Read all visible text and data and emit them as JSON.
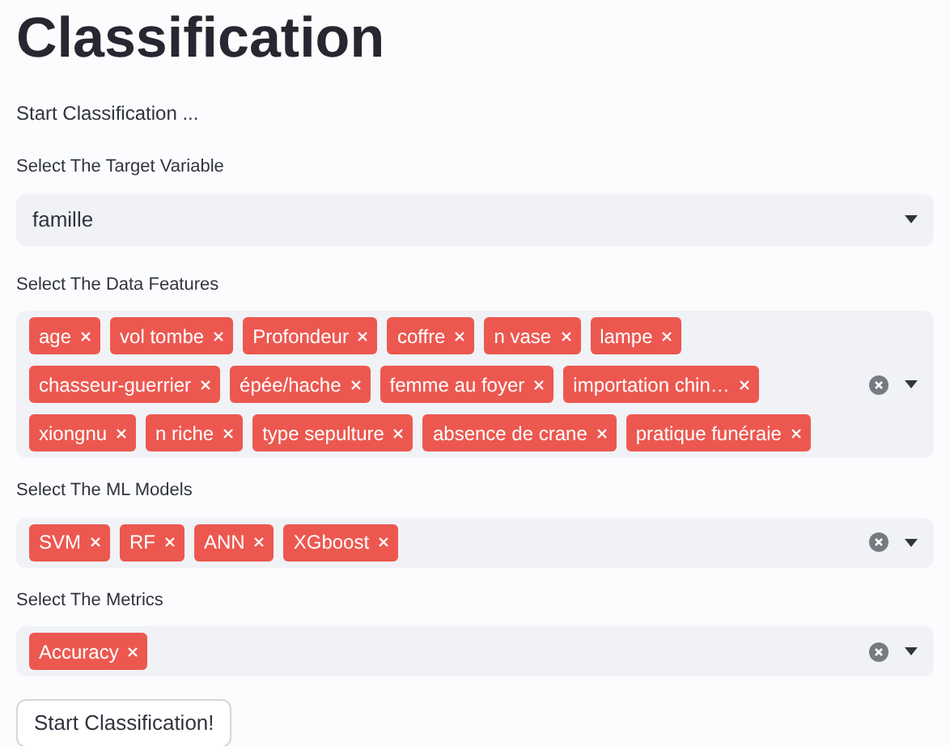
{
  "title": "Classification",
  "subtitle": "Start Classification ...",
  "target": {
    "label": "Select The Target Variable",
    "value": "famille"
  },
  "multiselects": [
    {
      "label": "Select The Data Features",
      "tags": [
        "age",
        "vol tombe",
        "Profondeur",
        "coffre",
        "n vase",
        "lampe",
        "chasseur-guerrier",
        "épée/hache",
        "femme au foyer",
        "importation chin…",
        "xiongnu",
        "n riche",
        "type sepulture",
        "absence de crane",
        "pratique funéraie"
      ]
    },
    {
      "label": "Select The ML Models",
      "tags": [
        "SVM",
        "RF",
        "ANN",
        "XGboost"
      ]
    },
    {
      "label": "Select The Metrics",
      "tags": [
        "Accuracy"
      ]
    }
  ],
  "button": "Start Classification!"
}
